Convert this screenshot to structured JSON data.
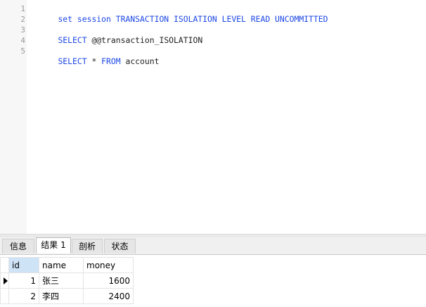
{
  "editor": {
    "lines": [
      {
        "no": "1",
        "parts": [
          {
            "t": "set session TRANSACTION ISOLATION LEVEL READ UNCOMMITTED",
            "k": true
          }
        ]
      },
      {
        "no": "2",
        "parts": []
      },
      {
        "no": "3",
        "parts": [
          {
            "t": "SELECT ",
            "k": true
          },
          {
            "t": "@@transaction_ISOLATION",
            "k": false
          }
        ]
      },
      {
        "no": "4",
        "parts": []
      },
      {
        "no": "5",
        "parts": [
          {
            "t": "SELECT",
            "k": true
          },
          {
            "t": " * ",
            "k": false
          },
          {
            "t": "FROM",
            "k": true
          },
          {
            "t": " account",
            "k": false
          }
        ]
      }
    ],
    "keyword_color": "#1c47e6"
  },
  "tabs": [
    {
      "label": "信息",
      "active": false
    },
    {
      "label": "结果 1",
      "active": true
    },
    {
      "label": "剖析",
      "active": false
    },
    {
      "label": "状态",
      "active": false
    }
  ],
  "grid": {
    "columns": [
      "id",
      "name",
      "money"
    ],
    "rows": [
      {
        "id": "1",
        "name": "张三",
        "money": "1600",
        "current": true
      },
      {
        "id": "2",
        "name": "李四",
        "money": "2400",
        "current": false
      }
    ]
  }
}
